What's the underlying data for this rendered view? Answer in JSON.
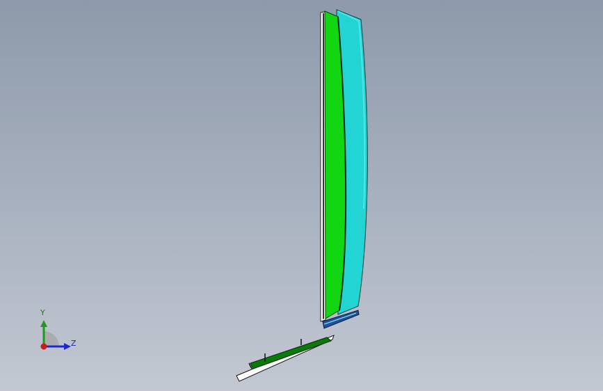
{
  "viewport": {
    "background_top": "#8e9aab",
    "background_bottom": "#c3c8d2"
  },
  "model": {
    "sail_front_color": "#12d612",
    "sail_back_color": "#22d4d4",
    "hull_color": "#0a7a0a",
    "edge_color": "#ffffff"
  },
  "triad": {
    "y_label": "Y",
    "z_label": "Z",
    "y_color": "#1f9a1f",
    "z_color": "#1a2ad0",
    "x_color": "#d01a1a",
    "icon": "coordinate-triad-icon"
  }
}
